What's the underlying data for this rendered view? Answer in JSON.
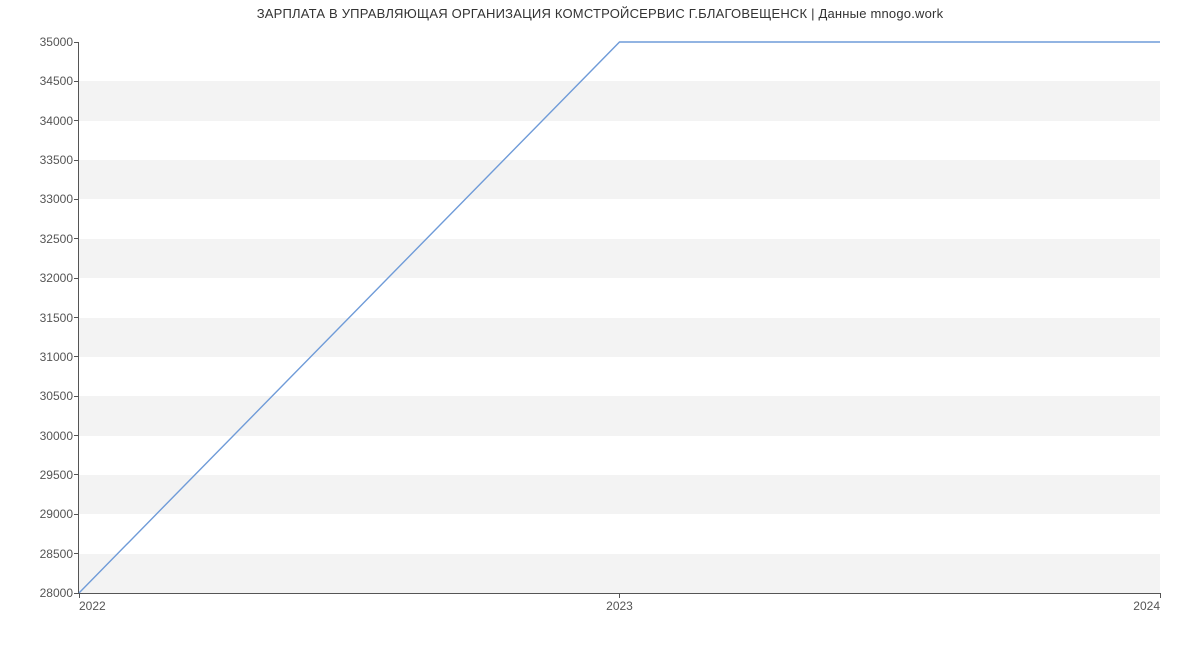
{
  "chart_data": {
    "type": "line",
    "title": "ЗАРПЛАТА В  УПРАВЛЯЮЩАЯ ОРГАНИЗАЦИЯ КОМСТРОЙСЕРВИС Г.БЛАГОВЕЩЕНСК | Данные mnogo.work",
    "xlabel": "",
    "ylabel": "",
    "x": [
      2022,
      2023,
      2024
    ],
    "series": [
      {
        "name": "salary",
        "values": [
          28000,
          35000,
          35000
        ]
      }
    ],
    "x_ticks": [
      2022,
      2023,
      2024
    ],
    "y_ticks": [
      28000,
      28500,
      29000,
      29500,
      30000,
      30500,
      31000,
      31500,
      32000,
      32500,
      33000,
      33500,
      34000,
      34500,
      35000
    ],
    "xlim": [
      2022,
      2024
    ],
    "ylim": [
      28000,
      35000
    ],
    "grid": "banded",
    "line_color": "#6f9bd8"
  }
}
